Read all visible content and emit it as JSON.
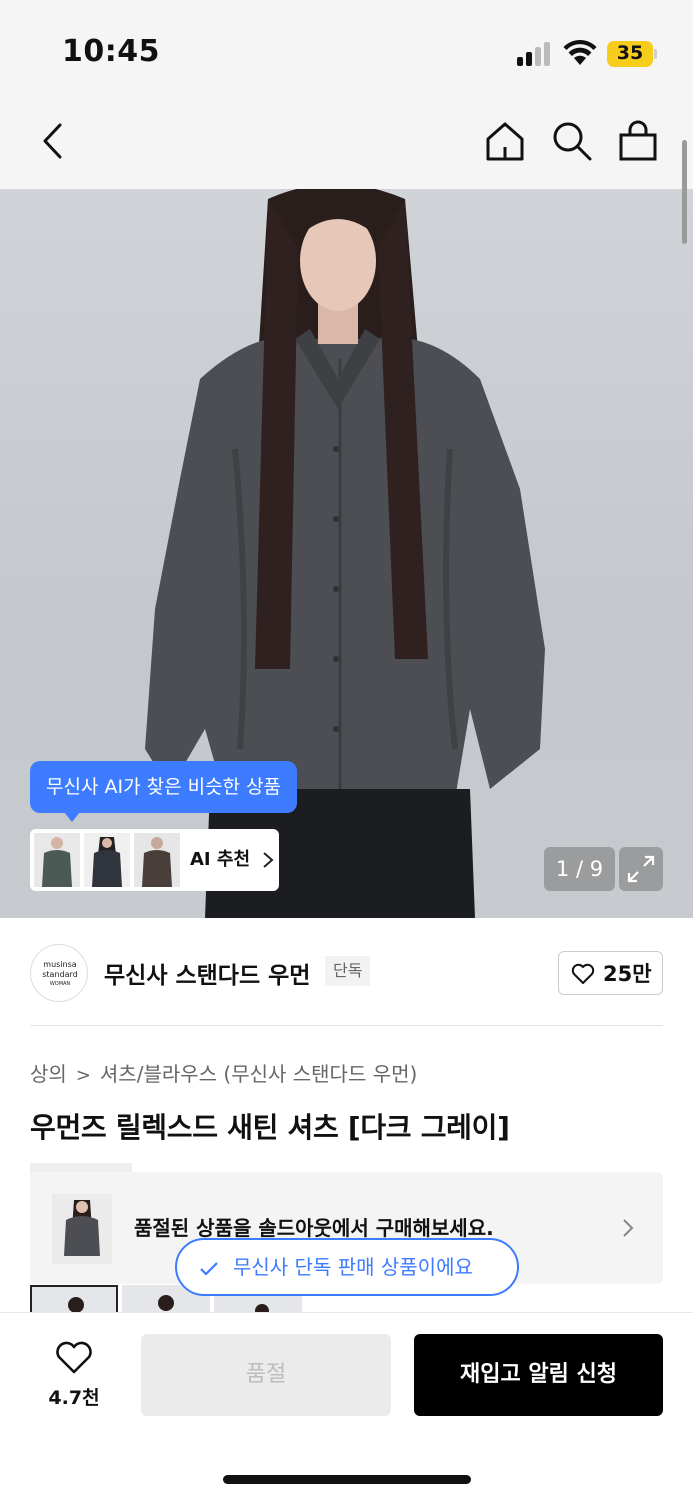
{
  "status_bar": {
    "time": "10:45",
    "battery": "35",
    "icons": [
      "cellular-signal-icon",
      "wifi-icon",
      "battery-icon"
    ]
  },
  "nav": {
    "icons": [
      "back-icon",
      "home-icon",
      "search-icon",
      "shopping-bag-icon"
    ]
  },
  "hero": {
    "ai_bubble": "무신사 AI가 찾은 비슷한 상품",
    "ai_recommend_label": "AI 추천",
    "pager": "1 / 9"
  },
  "brand": {
    "logo_line1": "musinsa",
    "logo_line2": "standard",
    "logo_line3": "WOMAN",
    "name": "무신사 스탠다드 우먼",
    "tag": "단독",
    "likes": "25만"
  },
  "breadcrumb": {
    "level1": "상의",
    "level2": "셔츠/블라우스 (무신사 스탠다드 우먼)"
  },
  "product": {
    "title": "우먼즈 릴렉스드 새틴 셔츠 [다크 그레이]"
  },
  "soldout_banner": {
    "text": "품절된 상품을 솔드아웃에서 구매해보세요."
  },
  "exclusive_toast": {
    "text": "무신사 단독 판매 상품이에요"
  },
  "bottom_bar": {
    "wish_count": "4.7천",
    "soldout_label": "품절",
    "restock_label": "재입고 알림 신청"
  },
  "colors": {
    "accent": "#3d7bff",
    "battery": "#f7cd1c",
    "primary_button": "#000000"
  }
}
